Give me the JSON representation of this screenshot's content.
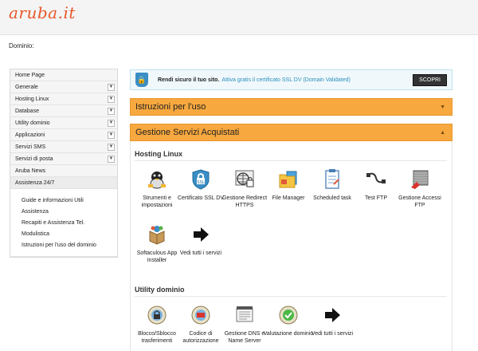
{
  "header": {
    "logo": "aruba.it"
  },
  "domain": {
    "label": "Dominio:"
  },
  "sidebar": {
    "items": [
      {
        "label": "Home Page",
        "chevron": false
      },
      {
        "label": "Generale",
        "chevron": true
      },
      {
        "label": "Hosting Linux",
        "chevron": true
      },
      {
        "label": "Database",
        "chevron": true
      },
      {
        "label": "Utility dominio",
        "chevron": true
      },
      {
        "label": "Applicazioni",
        "chevron": true
      },
      {
        "label": "Servizi SMS",
        "chevron": true
      },
      {
        "label": "Servizi di posta",
        "chevron": true
      },
      {
        "label": "Aruba News",
        "chevron": false
      },
      {
        "label": "Assistenza 24/7",
        "chevron": false
      }
    ],
    "sub_items": [
      "Guide e informazioni Utili",
      "Assistenza",
      "Recapiti e Assistenza Tel.",
      "Modulistica",
      "Istruzioni per l'uso del dominio"
    ]
  },
  "banner": {
    "text": "Rendi sicuro il tuo sito.",
    "link": "Attiva gratis il certificato SSL DV (Domain Validated)",
    "button": "SCOPRI"
  },
  "accordions": {
    "instructions": "Istruzioni per l'uso",
    "services": "Gestione Servizi Acquistati"
  },
  "hosting": {
    "title": "Hosting Linux",
    "tiles": [
      {
        "icon": "settings-tools-icon",
        "label": "Strumenti e impostazioni"
      },
      {
        "icon": "ssl-certificate-icon",
        "label": "Certificato SSL DV"
      },
      {
        "icon": "https-redirect-icon",
        "label": "Gestione Redirect HTTPS"
      },
      {
        "icon": "file-manager-icon",
        "label": "File Manager"
      },
      {
        "icon": "scheduled-task-icon",
        "label": "Scheduled task"
      },
      {
        "icon": "test-ftp-icon",
        "label": "Test FTP"
      },
      {
        "icon": "ftp-access-icon",
        "label": "Gestione Accessi FTP"
      },
      {
        "icon": "softaculous-icon",
        "label": "Softaculous App Installer"
      },
      {
        "icon": "arrow-right-icon",
        "label": "Vedi tutti i servizi"
      }
    ]
  },
  "utility": {
    "title": "Utility dominio",
    "tiles": [
      {
        "icon": "lock-unlock-icon",
        "label": "Blocco/Sblocco trasferimenti"
      },
      {
        "icon": "auth-code-icon",
        "label": "Codice di autorizzazione"
      },
      {
        "icon": "dns-icon",
        "label": "Gestione DNS e Name Server"
      },
      {
        "icon": "domain-valuation-icon",
        "label": "Valutazione dominio"
      },
      {
        "icon": "arrow-right-icon",
        "label": "Vedi tutti i servizi"
      }
    ]
  }
}
